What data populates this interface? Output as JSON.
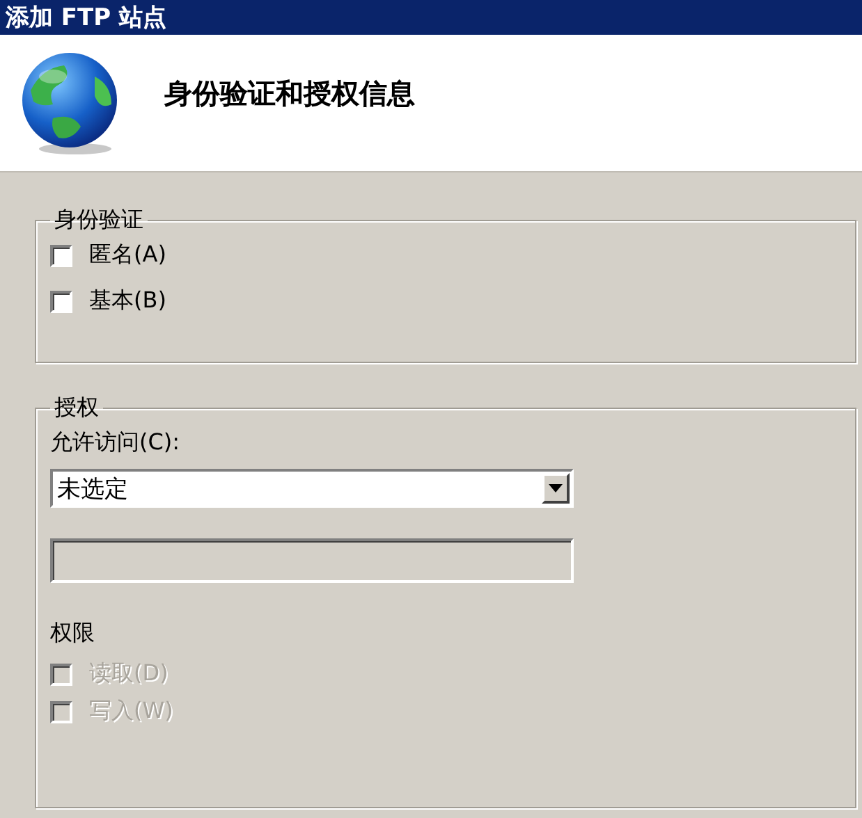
{
  "window": {
    "title": "添加 FTP 站点"
  },
  "header": {
    "title": "身份验证和授权信息"
  },
  "authentication": {
    "legend": "身份验证",
    "options": [
      {
        "label": "匿名(A)",
        "checked": false,
        "disabled": false
      },
      {
        "label": "基本(B)",
        "checked": false,
        "disabled": false
      }
    ]
  },
  "authorization": {
    "legend": "授权",
    "access_label": "允许访问(C):",
    "access_value": "未选定",
    "user_field": {
      "disabled": true
    },
    "permissions_label": "权限",
    "permissions": [
      {
        "label": "读取(D)",
        "checked": false,
        "disabled": true
      },
      {
        "label": "写入(W)",
        "checked": false,
        "disabled": true
      }
    ]
  }
}
